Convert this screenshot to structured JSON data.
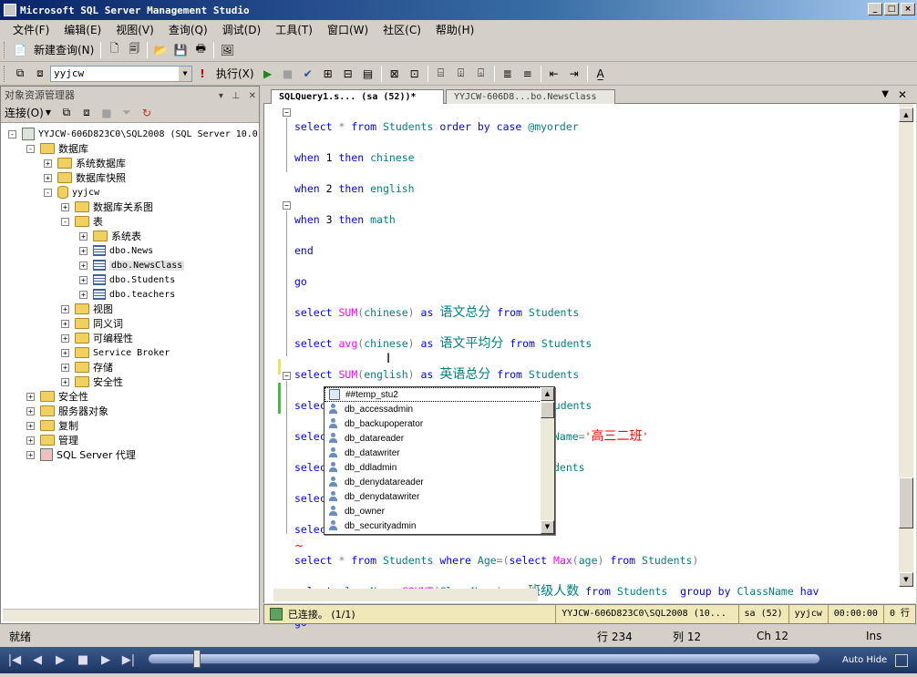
{
  "window": {
    "title": "Microsoft SQL Server Management Studio",
    "min": "_",
    "max": "□",
    "close": "×"
  },
  "menu": [
    "文件(F)",
    "编辑(E)",
    "视图(V)",
    "查询(Q)",
    "调试(D)",
    "工具(T)",
    "窗口(W)",
    "社区(C)",
    "帮助(H)"
  ],
  "toolbar1": {
    "new_query": "新建查询(N)"
  },
  "toolbar2": {
    "database": "yyjcw",
    "execute": "执行(X)"
  },
  "object_explorer": {
    "title": "对象资源管理器",
    "connect": "连接(O)",
    "nodes": [
      {
        "label": "YYJCW-606D823C0\\SQL2008 (SQL Server 10.0",
        "sign": "-"
      },
      {
        "label": "数据库",
        "sign": "-"
      },
      {
        "label": "系统数据库",
        "sign": "+"
      },
      {
        "label": "数据库快照",
        "sign": "+"
      },
      {
        "label": "yyjcw",
        "sign": "-"
      },
      {
        "label": "数据库关系图",
        "sign": "+"
      },
      {
        "label": "表",
        "sign": "-"
      },
      {
        "label": "系统表",
        "sign": "+"
      },
      {
        "label": "dbo.News",
        "sign": "+"
      },
      {
        "label": "dbo.NewsClass",
        "sign": "+"
      },
      {
        "label": "dbo.Students",
        "sign": "+"
      },
      {
        "label": "dbo.teachers",
        "sign": "+"
      },
      {
        "label": "视图",
        "sign": "+"
      },
      {
        "label": "同义词",
        "sign": "+"
      },
      {
        "label": "可编程性",
        "sign": "+"
      },
      {
        "label": "Service Broker",
        "sign": "+"
      },
      {
        "label": "存储",
        "sign": "+"
      },
      {
        "label": "安全性",
        "sign": "+"
      },
      {
        "label": "安全性",
        "sign": "+"
      },
      {
        "label": "服务器对象",
        "sign": "+"
      },
      {
        "label": "复制",
        "sign": "+"
      },
      {
        "label": "管理",
        "sign": "+"
      },
      {
        "label": "SQL Server 代理",
        "sign": "+"
      }
    ]
  },
  "tabs": {
    "active": "SQLQuery1.s... (sa (52))*",
    "inactive": "YYJCW-606D8...bo.NewsClass"
  },
  "autocomplete": [
    "##temp_stu2",
    "db_accessadmin",
    "db_backupoperator",
    "db_datareader",
    "db_datawriter",
    "db_ddladmin",
    "db_denydatareader",
    "db_denydatawriter",
    "db_owner",
    "db_securityadmin"
  ],
  "editor_status": {
    "connected": "已连接。 (1/1)",
    "server": "YYJCW-606D823C0\\SQL2008 (10...",
    "user": "sa (52)",
    "db": "yyjcw",
    "time": "00:00:00",
    "rows": "0 行"
  },
  "statusbar": {
    "ready": "就绪",
    "line": "行 234",
    "col": "列 12",
    "ch": "Ch 12",
    "ins": "Ins"
  },
  "taskbar": {
    "autohide": "Auto Hide"
  }
}
